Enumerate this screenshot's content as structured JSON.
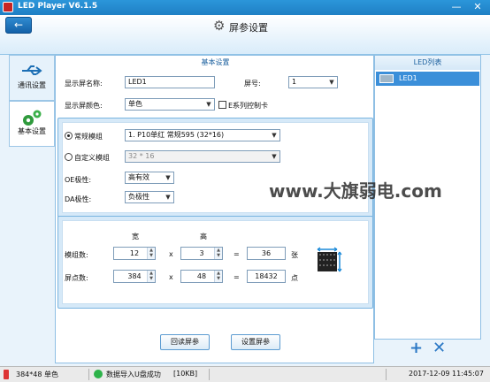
{
  "window": {
    "title": "LED Player V6.1.5",
    "minimize": "—",
    "close": "✕"
  },
  "header": {
    "title": "屏参设置",
    "back_icon": "arrow-left-icon",
    "gear_icon": "gear-icon"
  },
  "nav": {
    "items": [
      {
        "label": "通讯设置",
        "icon": "usb-icon"
      },
      {
        "label": "基本设置",
        "icon": "gears-icon",
        "active": true
      }
    ]
  },
  "basic": {
    "section_title": "基本设置",
    "screen_name_label": "显示屏名称:",
    "screen_name_value": "LED1",
    "screen_no_label": "屏号:",
    "screen_no_value": "1",
    "color_label": "显示屏颜色:",
    "color_value": "单色",
    "ecard_label": "E系列控制卡",
    "ecard_checked": false
  },
  "module": {
    "normal_label": "常规模组",
    "normal_checked": true,
    "normal_value": "1. P10单红 常规595 (32*16)",
    "custom_label": "自定义模组",
    "custom_checked": false,
    "custom_value": "32 * 16",
    "oe_label": "OE极性:",
    "oe_value": "高有效",
    "da_label": "DA极性:",
    "da_value": "负极性"
  },
  "size": {
    "width_header": "宽",
    "height_header": "高",
    "modules_label": "模组数:",
    "modules_w": "12",
    "modules_h": "3",
    "modules_total": "36",
    "modules_unit": "张",
    "pixels_label": "屏点数:",
    "pixels_w": "384",
    "pixels_h": "48",
    "pixels_total": "18432",
    "pixels_unit": "点",
    "times": "x",
    "equals": "="
  },
  "buttons": {
    "readback": "回读屏参",
    "apply": "设置屏参"
  },
  "led_list": {
    "title": "LED列表",
    "items": [
      {
        "name": "LED1"
      }
    ],
    "add": "+",
    "remove": "✕"
  },
  "status": {
    "resolution": "384*48 单色",
    "message": "数据导入U盘成功",
    "size": "[10KB]",
    "datetime": "2017-12-09 11:45:07"
  },
  "watermark": "www.大旗弱电.com",
  "colors": {
    "accent": "#2b96da",
    "selection": "#3b8fd9",
    "panel": "#d6e9f8"
  }
}
